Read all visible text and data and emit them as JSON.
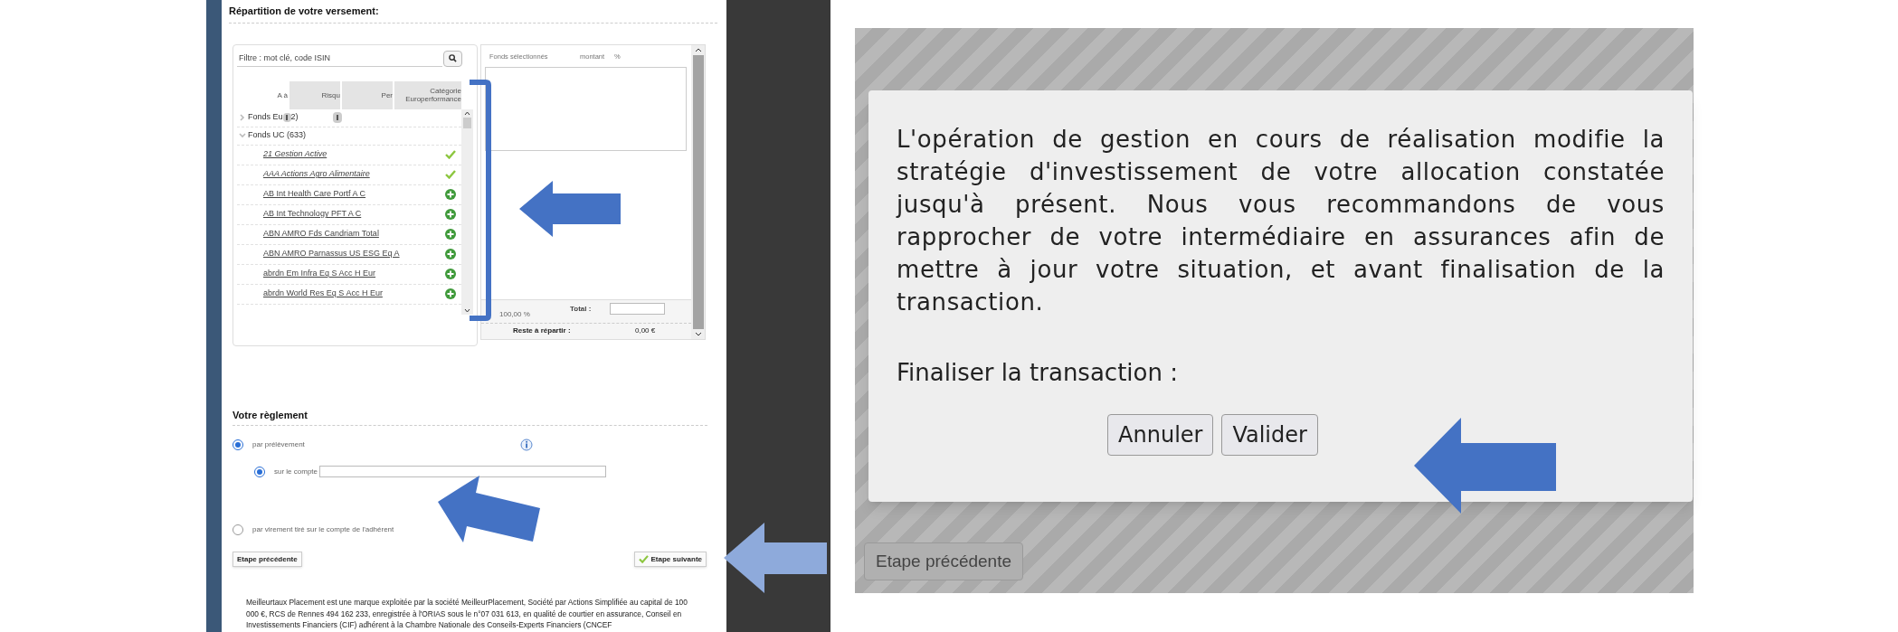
{
  "left_screenshot": {
    "section_title": "Répartition de votre versement:",
    "fund_picker": {
      "filter_placeholder": "Filtre : mot clé, code ISIN",
      "columns": [
        "A à",
        "Risqu",
        "Per",
        "Catégorie Europerformance"
      ],
      "groups": [
        {
          "label_start": "Fonds Eu",
          "label_end": "2)",
          "expanded": false
        },
        {
          "label_start": "Fonds UC (633)",
          "expanded": true,
          "funds": [
            {
              "name": "21 Gestion Active",
              "added": true
            },
            {
              "name": "AAA Actions Agro Alimentaire",
              "added": true
            },
            {
              "name": "AB Int Health Care Portf A C",
              "added": false
            },
            {
              "name": "AB Int Technology PFT A C",
              "added": false
            },
            {
              "name": "ABN AMRO Fds Candriam Total",
              "added": false
            },
            {
              "name": "ABN AMRO Parnassus US ESG Eq A",
              "added": false
            },
            {
              "name": "abrdn Em Infra Eq S Acc H Eur",
              "added": false
            },
            {
              "name": "abrdn World Res Eq S Acc H Eur",
              "added": false
            }
          ]
        }
      ]
    },
    "selected_funds": {
      "columns": [
        "Fonds sélectionnés",
        "montant",
        "%"
      ],
      "percent": "100,00 %",
      "total_label": "Total :",
      "remaining_label": "Reste à répartir :",
      "remaining_value": "0,00 €"
    },
    "payment": {
      "title": "Votre règlement",
      "options": [
        {
          "label": "par prélèvement",
          "selected": true,
          "children": [
            {
              "label": "sur le compte",
              "selected": true
            }
          ]
        },
        {
          "label": "par virement tiré sur le compte de l'adhérent",
          "selected": false
        }
      ]
    },
    "back_button": "Etape précédente",
    "next_button": "Etape suivante",
    "legal_text": "Meilleurtaux Placement est une marque exploitée par la société MeilleurPlacement, Société par Actions Simplifiée au capital de 100 000 €, RCS de Rennes 494 162 233, enregistrée à l'ORIAS sous le n°07 031 613, en qualité de courtier en assurance, Conseil en Investissements Financiers (CIF) adhérent à la Chambre Nationale des Conseils-Experts Financiers (CNCEF"
  },
  "right_screenshot": {
    "dialog": {
      "message": "L'opération de gestion en cours de réalisation modifie la stratégie d'investissement de votre allocation constatée jusqu'à présent. Nous vous recommandons de vous rapprocher de votre intermédiaire en assurances afin de mettre à jour votre situation, et avant finalisation de la transaction.",
      "prompt": "Finaliser la transaction :",
      "buttons": [
        "Annuler",
        "Valider"
      ]
    },
    "background_button": "Etape précédente"
  }
}
